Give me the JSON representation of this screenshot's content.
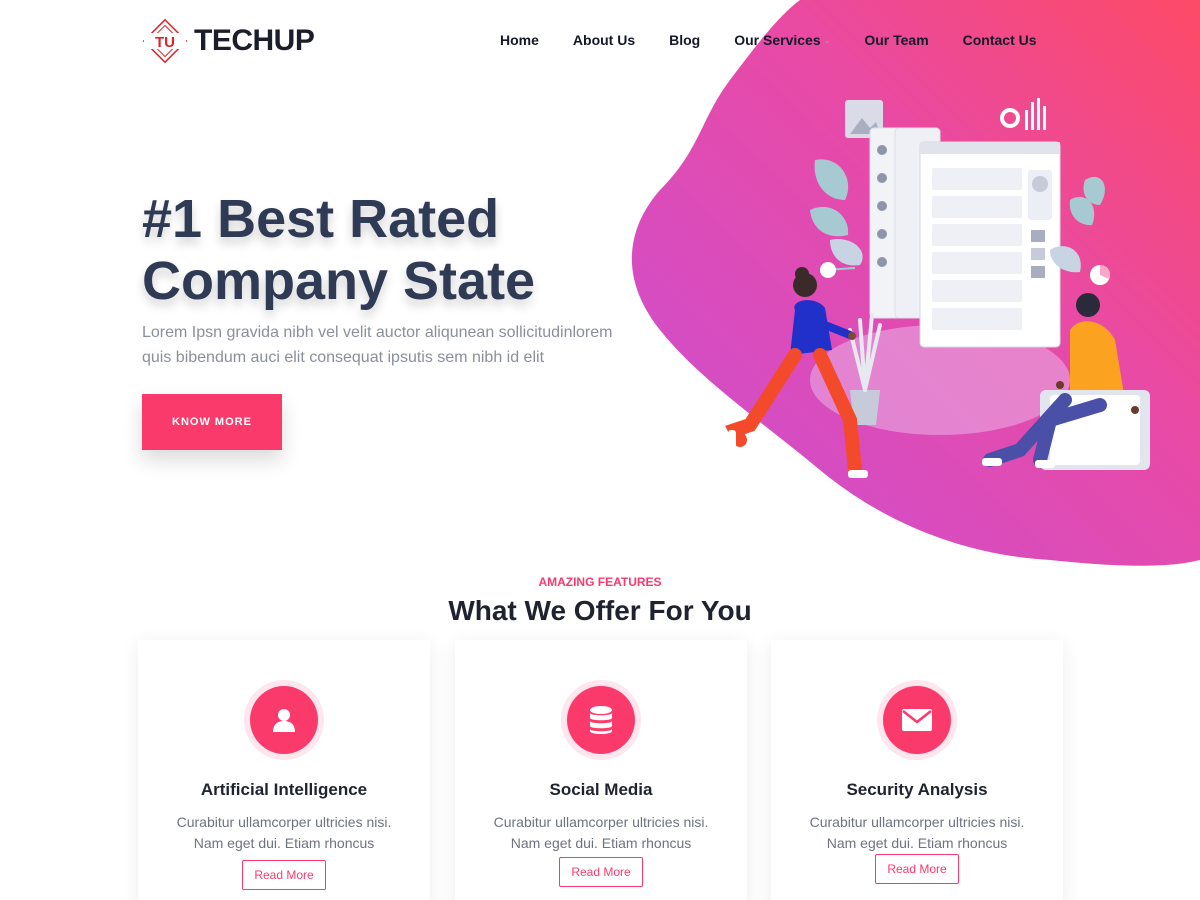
{
  "brand": {
    "mark": "TU",
    "name": "TECHUP"
  },
  "nav": [
    {
      "label": "Home"
    },
    {
      "label": "About Us"
    },
    {
      "label": "Blog"
    },
    {
      "label": "Our Services",
      "dropdown": true
    },
    {
      "label": "Our Team"
    },
    {
      "label": "Contact Us"
    }
  ],
  "hero": {
    "title_line1": "#1 Best Rated",
    "title_line2": "Company State",
    "desc_line1": "Lorem Ipsn gravida nibh vel velit auctor aliqunean sollicitudinlorem",
    "desc_line2": "quis bibendum auci elit consequat ipsutis sem nibh id elit",
    "button": "KNOW MORE"
  },
  "features": {
    "eyebrow": "AMAZING FEATURES",
    "title": "What We Offer For You",
    "cards": [
      {
        "icon": "user-icon",
        "title": "Artificial Intelligence",
        "text_line1": "Curabitur ullamcorper ultricies nisi.",
        "text_line2": "Nam eget dui. Etiam rhoncus",
        "button": "Read More"
      },
      {
        "icon": "database-icon",
        "title": "Social Media",
        "text_line1": "Curabitur ullamcorper ultricies nisi.",
        "text_line2": "Nam eget dui. Etiam rhoncus",
        "button": "Read More"
      },
      {
        "icon": "envelope-icon",
        "title": "Security Analysis",
        "text_line1": "Curabitur ullamcorper ultricies nisi.",
        "text_line2": "Nam eget dui. Etiam rhoncus",
        "button": "Read More"
      }
    ]
  },
  "colors": {
    "accent": "#fb3a6c",
    "blob_start": "#c84fd6",
    "blob_end": "#fd4a6a",
    "heading": "#2f3a54"
  }
}
